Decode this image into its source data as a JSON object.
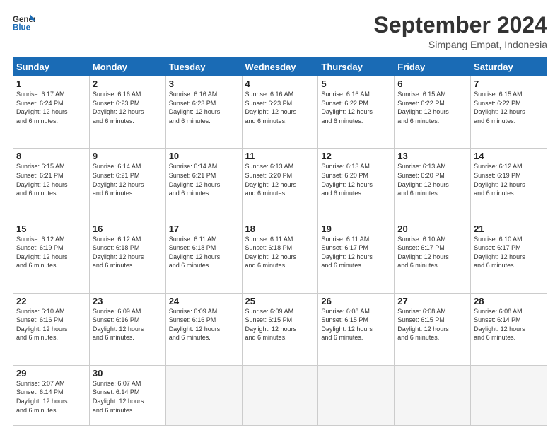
{
  "header": {
    "logo_line1": "General",
    "logo_line2": "Blue",
    "month": "September 2024",
    "location": "Simpang Empat, Indonesia"
  },
  "days_of_week": [
    "Sunday",
    "Monday",
    "Tuesday",
    "Wednesday",
    "Thursday",
    "Friday",
    "Saturday"
  ],
  "weeks": [
    [
      {
        "day": "1",
        "sunrise": "6:17 AM",
        "sunset": "6:24 PM",
        "daylight": "12 hours and 6 minutes."
      },
      {
        "day": "2",
        "sunrise": "6:16 AM",
        "sunset": "6:23 PM",
        "daylight": "12 hours and 6 minutes."
      },
      {
        "day": "3",
        "sunrise": "6:16 AM",
        "sunset": "6:23 PM",
        "daylight": "12 hours and 6 minutes."
      },
      {
        "day": "4",
        "sunrise": "6:16 AM",
        "sunset": "6:23 PM",
        "daylight": "12 hours and 6 minutes."
      },
      {
        "day": "5",
        "sunrise": "6:16 AM",
        "sunset": "6:22 PM",
        "daylight": "12 hours and 6 minutes."
      },
      {
        "day": "6",
        "sunrise": "6:15 AM",
        "sunset": "6:22 PM",
        "daylight": "12 hours and 6 minutes."
      },
      {
        "day": "7",
        "sunrise": "6:15 AM",
        "sunset": "6:22 PM",
        "daylight": "12 hours and 6 minutes."
      }
    ],
    [
      {
        "day": "8",
        "sunrise": "6:15 AM",
        "sunset": "6:21 PM",
        "daylight": "12 hours and 6 minutes."
      },
      {
        "day": "9",
        "sunrise": "6:14 AM",
        "sunset": "6:21 PM",
        "daylight": "12 hours and 6 minutes."
      },
      {
        "day": "10",
        "sunrise": "6:14 AM",
        "sunset": "6:21 PM",
        "daylight": "12 hours and 6 minutes."
      },
      {
        "day": "11",
        "sunrise": "6:13 AM",
        "sunset": "6:20 PM",
        "daylight": "12 hours and 6 minutes."
      },
      {
        "day": "12",
        "sunrise": "6:13 AM",
        "sunset": "6:20 PM",
        "daylight": "12 hours and 6 minutes."
      },
      {
        "day": "13",
        "sunrise": "6:13 AM",
        "sunset": "6:20 PM",
        "daylight": "12 hours and 6 minutes."
      },
      {
        "day": "14",
        "sunrise": "6:12 AM",
        "sunset": "6:19 PM",
        "daylight": "12 hours and 6 minutes."
      }
    ],
    [
      {
        "day": "15",
        "sunrise": "6:12 AM",
        "sunset": "6:19 PM",
        "daylight": "12 hours and 6 minutes."
      },
      {
        "day": "16",
        "sunrise": "6:12 AM",
        "sunset": "6:18 PM",
        "daylight": "12 hours and 6 minutes."
      },
      {
        "day": "17",
        "sunrise": "6:11 AM",
        "sunset": "6:18 PM",
        "daylight": "12 hours and 6 minutes."
      },
      {
        "day": "18",
        "sunrise": "6:11 AM",
        "sunset": "6:18 PM",
        "daylight": "12 hours and 6 minutes."
      },
      {
        "day": "19",
        "sunrise": "6:11 AM",
        "sunset": "6:17 PM",
        "daylight": "12 hours and 6 minutes."
      },
      {
        "day": "20",
        "sunrise": "6:10 AM",
        "sunset": "6:17 PM",
        "daylight": "12 hours and 6 minutes."
      },
      {
        "day": "21",
        "sunrise": "6:10 AM",
        "sunset": "6:17 PM",
        "daylight": "12 hours and 6 minutes."
      }
    ],
    [
      {
        "day": "22",
        "sunrise": "6:10 AM",
        "sunset": "6:16 PM",
        "daylight": "12 hours and 6 minutes."
      },
      {
        "day": "23",
        "sunrise": "6:09 AM",
        "sunset": "6:16 PM",
        "daylight": "12 hours and 6 minutes."
      },
      {
        "day": "24",
        "sunrise": "6:09 AM",
        "sunset": "6:16 PM",
        "daylight": "12 hours and 6 minutes."
      },
      {
        "day": "25",
        "sunrise": "6:09 AM",
        "sunset": "6:15 PM",
        "daylight": "12 hours and 6 minutes."
      },
      {
        "day": "26",
        "sunrise": "6:08 AM",
        "sunset": "6:15 PM",
        "daylight": "12 hours and 6 minutes."
      },
      {
        "day": "27",
        "sunrise": "6:08 AM",
        "sunset": "6:15 PM",
        "daylight": "12 hours and 6 minutes."
      },
      {
        "day": "28",
        "sunrise": "6:08 AM",
        "sunset": "6:14 PM",
        "daylight": "12 hours and 6 minutes."
      }
    ],
    [
      {
        "day": "29",
        "sunrise": "6:07 AM",
        "sunset": "6:14 PM",
        "daylight": "12 hours and 6 minutes."
      },
      {
        "day": "30",
        "sunrise": "6:07 AM",
        "sunset": "6:14 PM",
        "daylight": "12 hours and 6 minutes."
      },
      null,
      null,
      null,
      null,
      null
    ]
  ],
  "labels": {
    "sunrise": "Sunrise:",
    "sunset": "Sunset:",
    "daylight": "Daylight:"
  }
}
